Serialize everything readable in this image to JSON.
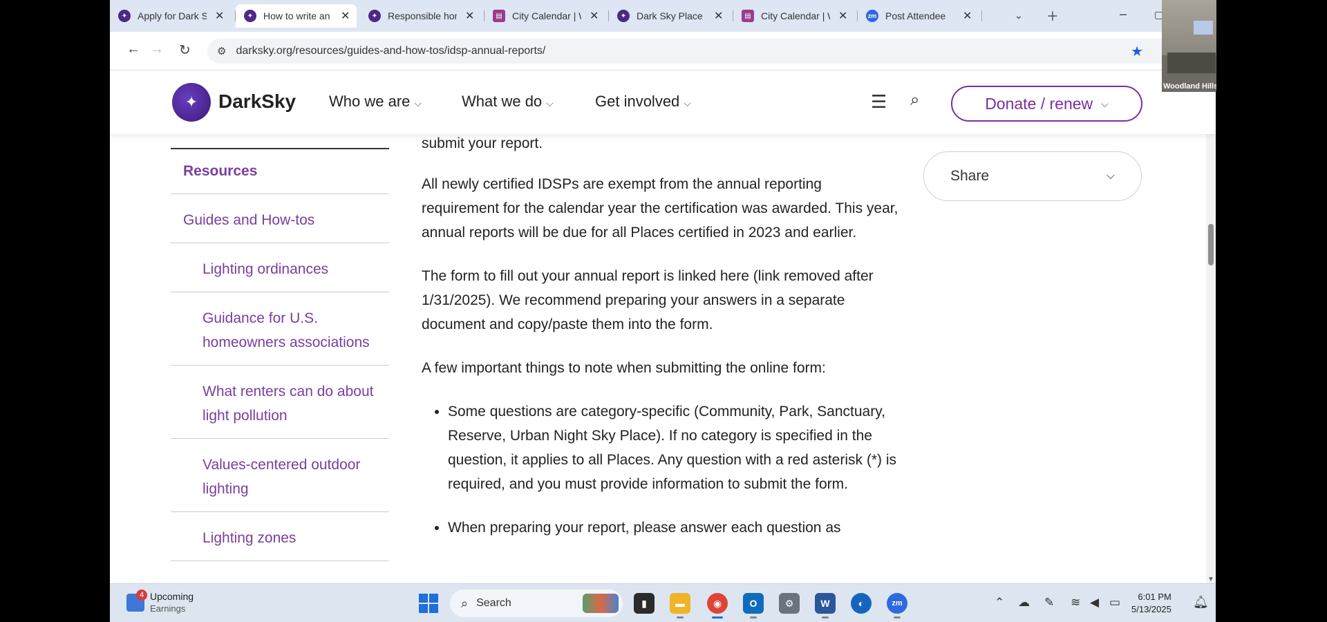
{
  "browser": {
    "tabs": [
      {
        "label": "Apply for Dark Sky",
        "icon": "darksky-favicon"
      },
      {
        "label": "How to write an annual report",
        "icon": "darksky-favicon",
        "active": true
      },
      {
        "label": "Responsible home lighting",
        "icon": "darksky-favicon"
      },
      {
        "label": "City Calendar | Woodland Hills",
        "icon": "calendar-favicon"
      },
      {
        "label": "Dark Sky Place",
        "icon": "darksky-favicon"
      },
      {
        "label": "City Calendar | Woodland Hills",
        "icon": "calendar-favicon"
      },
      {
        "label": "Post Attendee",
        "icon": "zoom-favicon"
      }
    ],
    "url": "darksky.org/resources/guides-and-how-tos/idsp-annual-reports/"
  },
  "site": {
    "logo": "DarkSky",
    "nav": [
      "Who we are",
      "What we do",
      "Get involved"
    ],
    "donate_label": "Donate / renew"
  },
  "sidebar": {
    "items": [
      {
        "label": "Resources",
        "level": "heading"
      },
      {
        "label": "Guides and How-tos",
        "level": "l1"
      },
      {
        "label": "Lighting ordinances",
        "level": "l2"
      },
      {
        "label": "Guidance for U.S. homeowners associations",
        "level": "l2"
      },
      {
        "label": "What renters can do about light pollution",
        "level": "l2"
      },
      {
        "label": "Values-centered outdoor lighting",
        "level": "l2"
      },
      {
        "label": "Lighting zones",
        "level": "l2"
      }
    ]
  },
  "article": {
    "p0": "submit your report.",
    "p1": "All newly certified IDSPs are exempt from the annual reporting requirement for the calendar year the certification was awarded. This year, annual reports will be due for all Places certified in 2023 and earlier.",
    "p2": "The form to fill out your annual report is linked here (link removed after 1/31/2025). We recommend preparing your answers in a separate document and copy/paste them into the form.",
    "p3": "A few important things to note when submitting the online form:",
    "bullets": [
      "Some questions are category-specific (Community, Park, Sanctuary, Reserve, Urban Night Sky Place). If no category is specified in the question, it applies to all Places. Any question with a red asterisk (*) is required, and you must provide information to submit the form.",
      "When preparing your report, please answer each question as"
    ]
  },
  "share_label": "Share",
  "taskbar": {
    "widget_badge": "4",
    "widget_title": "Upcoming",
    "widget_subtitle": "Earnings",
    "search_placeholder": "Search",
    "time": "6:01 PM",
    "date": "5/13/2025"
  },
  "video": {
    "label": "Woodland Hills City"
  },
  "colors": {
    "brand_purple": "#7a2e9e",
    "link_purple": "#7a3e9e",
    "star_blue": "#1a62d6"
  }
}
